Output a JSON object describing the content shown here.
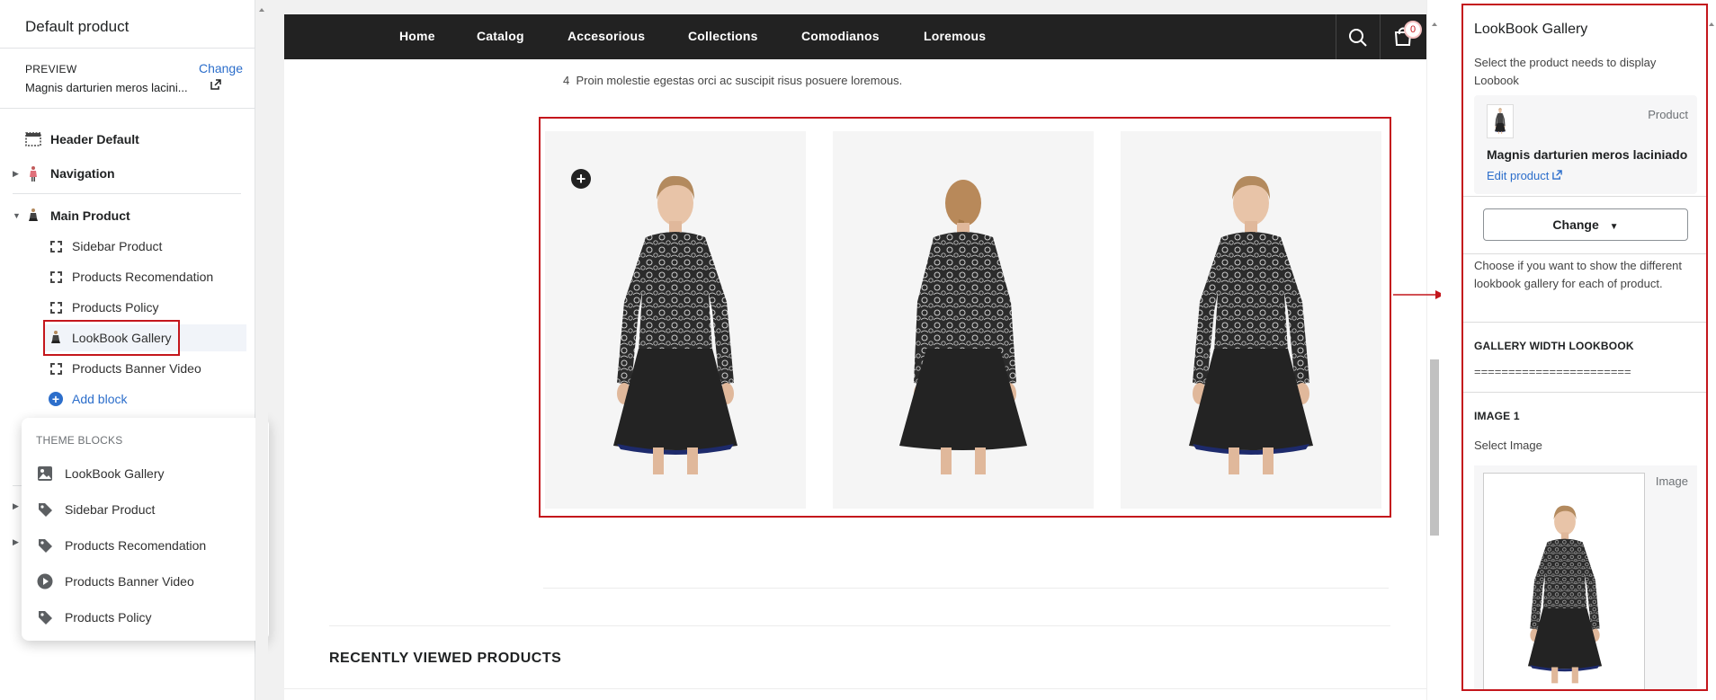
{
  "sidebar": {
    "title": "Default product",
    "preview_label": "PREVIEW",
    "preview_change": "Change",
    "preview_value": "Magnis darturien meros lacini...",
    "items": [
      {
        "label": "Header Default",
        "icon": "header-icon"
      },
      {
        "label": "Navigation",
        "icon": "figure-icon"
      },
      {
        "label": "Main Product",
        "icon": "figure-icon"
      },
      {
        "label": "Sidebar Product",
        "icon": "dashed-square-icon"
      },
      {
        "label": "Products Recomendation",
        "icon": "dashed-square-icon"
      },
      {
        "label": "Products Policy",
        "icon": "dashed-square-icon"
      },
      {
        "label": "LookBook Gallery",
        "icon": "figure-icon"
      },
      {
        "label": "Products Banner Video",
        "icon": "dashed-square-icon"
      },
      {
        "label": "Add block",
        "icon": "plus-circle-icon"
      }
    ]
  },
  "popover": {
    "heading": "THEME BLOCKS",
    "items": [
      {
        "label": "LookBook Gallery",
        "icon": "image-icon"
      },
      {
        "label": "Sidebar Product",
        "icon": "tag-icon"
      },
      {
        "label": "Products Recomendation",
        "icon": "tag-icon"
      },
      {
        "label": "Products Banner Video",
        "icon": "play-icon"
      },
      {
        "label": "Products Policy",
        "icon": "tag-icon"
      }
    ]
  },
  "store": {
    "nav": [
      "Home",
      "Catalog",
      "Accesorious",
      "Collections",
      "Comodianos",
      "Loremous"
    ],
    "cart_count": "0",
    "list_number": "4",
    "list_text": "Proin molestie egestas orci ac suscipit risus posuere loremous.",
    "recently_viewed": "RECENTLY VIEWED PRODUCTS"
  },
  "panel": {
    "title": "LookBook Gallery",
    "select_text": "Select the product needs to display Loobook",
    "product_label": "Product",
    "product_name": "Magnis darturien meros laciniado",
    "edit_product": "Edit product",
    "change_button": "Change",
    "choose_text": "Choose if you want to show the different lookbook gallery for each of product.",
    "gallery_width_heading": "GALLERY WIDTH LOOKBOOK",
    "gallery_width_value": "=======================",
    "image1_heading": "IMAGE 1",
    "select_image": "Select Image",
    "image_label": "Image"
  },
  "colors": {
    "highlight": "#c4161c",
    "link": "#2c6ecb",
    "navbar": "#222222"
  }
}
